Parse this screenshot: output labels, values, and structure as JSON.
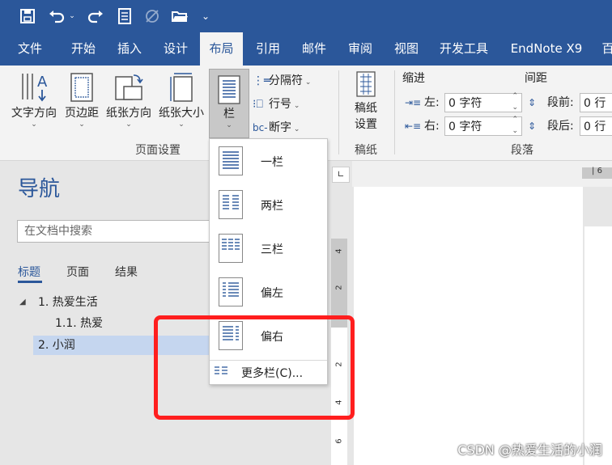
{
  "quick_access": {
    "icons": [
      "save-icon",
      "undo-icon",
      "redo-icon",
      "touch-mode-icon",
      "draw-icon",
      "open-folder-icon",
      "customize-icon"
    ]
  },
  "menu": {
    "tabs": [
      "文件",
      "开始",
      "插入",
      "设计",
      "布局",
      "引用",
      "邮件",
      "审阅",
      "视图",
      "开发工具",
      "EndNote X9",
      "百"
    ],
    "active": "布局"
  },
  "ribbon": {
    "page_setup": {
      "text_direction": "文字方向",
      "margins": "页边距",
      "orientation": "纸张方向",
      "size": "纸张大小",
      "columns": "栏",
      "breaks": "分隔符",
      "line_numbers": "行号",
      "hyphenation": "断字",
      "group_label": "页面设置"
    },
    "manuscript": {
      "button_line1": "稿纸",
      "button_line2": "设置",
      "group_label": "稿纸"
    },
    "paragraph": {
      "indent_header": "缩进",
      "spacing_header": "间距",
      "left_label": "左:",
      "left_value": "0 字符",
      "right_label": "右:",
      "right_value": "0 字符",
      "before_label": "段前:",
      "before_value": "0 行",
      "after_label": "段后:",
      "after_value": "0 行",
      "group_label": "段落"
    }
  },
  "nav": {
    "title": "导航",
    "search_placeholder": "在文档中搜索",
    "tabs": [
      "标题",
      "页面",
      "结果"
    ],
    "active_tab": "标题",
    "headings": [
      {
        "text": "1. 热爱生活",
        "level": 1,
        "expanded": true
      },
      {
        "text": "1.1. 热爱",
        "level": 2
      },
      {
        "text": "2. 小润",
        "level": 1,
        "selected": true
      }
    ]
  },
  "columns_menu": {
    "items": [
      "一栏",
      "两栏",
      "三栏",
      "偏左",
      "偏右"
    ],
    "selected": "一栏",
    "more": "更多栏(C)..."
  },
  "ruler": {
    "h_label": "6",
    "v_labels": [
      "4",
      "2",
      "2",
      "4",
      "6"
    ]
  },
  "watermark": "CSDN @热爱生活的小润",
  "colors": {
    "brand": "#2b579a",
    "highlight": "#ff1e1e",
    "nav_selected": "#c5d6ef"
  }
}
